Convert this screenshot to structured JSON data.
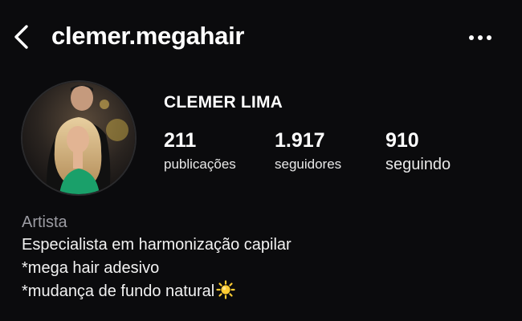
{
  "header": {
    "username": "clemer.megahair",
    "back_icon": "chevron-left-icon",
    "more_icon": "more-horizontal-icon"
  },
  "profile": {
    "display_name": "CLEMER LIMA",
    "avatar": "profile-photo"
  },
  "stats": {
    "posts": {
      "value": "211",
      "label": "publicações"
    },
    "followers": {
      "value": "1.917",
      "label": "seguidores"
    },
    "following": {
      "value": "910",
      "label": "seguindo"
    }
  },
  "bio": {
    "category": "Artista",
    "lines": [
      "Especialista em harmonização capilar",
      "*mega hair adesivo",
      "*mudança de fundo natural"
    ],
    "emoji": "sun-emoji"
  },
  "colors": {
    "background": "#0b0b0d",
    "text": "#ffffff",
    "category": "#9c9ca3",
    "sun": "#ffcc33"
  }
}
